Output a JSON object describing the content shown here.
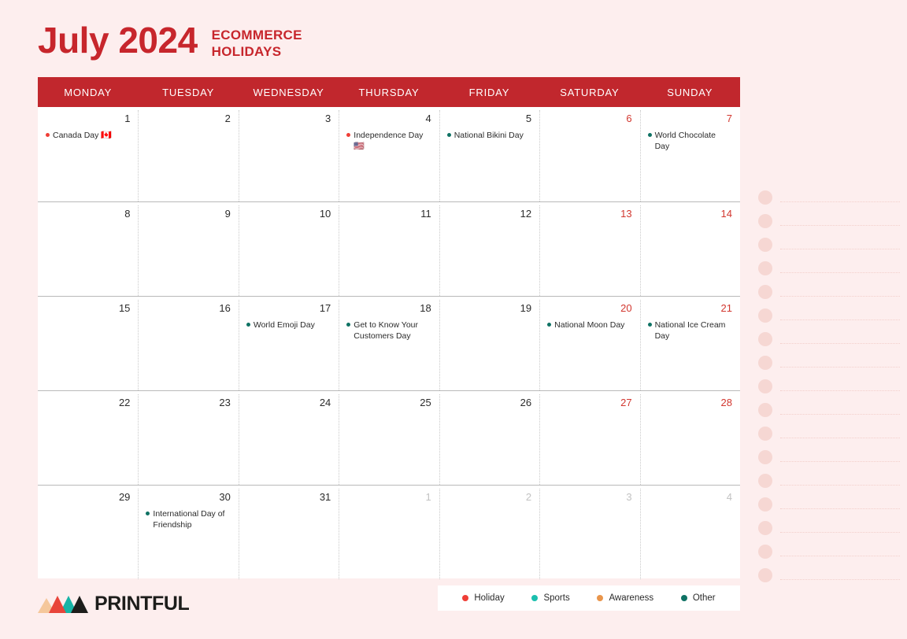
{
  "header": {
    "month_year": "July 2024",
    "subtitle_line1": "ECOMMERCE",
    "subtitle_line2": "HOLIDAYS",
    "accent_color": "#c7262c"
  },
  "calendar": {
    "weekday_headers": [
      "MONDAY",
      "TUESDAY",
      "WEDNESDAY",
      "THURSDAY",
      "FRIDAY",
      "SATURDAY",
      "SUNDAY"
    ],
    "header_bg": "#c1272d",
    "weeks": [
      [
        {
          "date": "1",
          "weekend": false,
          "muted": false,
          "events": [
            {
              "text": "Canada Day",
              "flag": "🇨🇦",
              "color": "#ef3e36",
              "category": "Holiday"
            }
          ]
        },
        {
          "date": "2",
          "weekend": false,
          "muted": false,
          "events": []
        },
        {
          "date": "3",
          "weekend": false,
          "muted": false,
          "events": []
        },
        {
          "date": "4",
          "weekend": false,
          "muted": false,
          "events": [
            {
              "text": "Independence Day",
              "flag": "🇺🇸",
              "color": "#ef3e36",
              "category": "Holiday"
            }
          ]
        },
        {
          "date": "5",
          "weekend": false,
          "muted": false,
          "events": [
            {
              "text": "National Bikini Day",
              "flag": "",
              "color": "#0f7264",
              "category": "Other"
            }
          ]
        },
        {
          "date": "6",
          "weekend": true,
          "muted": false,
          "events": []
        },
        {
          "date": "7",
          "weekend": true,
          "muted": false,
          "events": [
            {
              "text": "World Chocolate Day",
              "flag": "",
              "color": "#0f7264",
              "category": "Other"
            }
          ]
        }
      ],
      [
        {
          "date": "8",
          "weekend": false,
          "muted": false,
          "events": []
        },
        {
          "date": "9",
          "weekend": false,
          "muted": false,
          "events": []
        },
        {
          "date": "10",
          "weekend": false,
          "muted": false,
          "events": []
        },
        {
          "date": "11",
          "weekend": false,
          "muted": false,
          "events": []
        },
        {
          "date": "12",
          "weekend": false,
          "muted": false,
          "events": []
        },
        {
          "date": "13",
          "weekend": true,
          "muted": false,
          "events": []
        },
        {
          "date": "14",
          "weekend": true,
          "muted": false,
          "events": []
        }
      ],
      [
        {
          "date": "15",
          "weekend": false,
          "muted": false,
          "events": []
        },
        {
          "date": "16",
          "weekend": false,
          "muted": false,
          "events": []
        },
        {
          "date": "17",
          "weekend": false,
          "muted": false,
          "events": [
            {
              "text": "World Emoji Day",
              "flag": "",
              "color": "#0f7264",
              "category": "Other"
            }
          ]
        },
        {
          "date": "18",
          "weekend": false,
          "muted": false,
          "events": [
            {
              "text": "Get to Know Your Customers Day",
              "flag": "",
              "color": "#0f7264",
              "category": "Other"
            }
          ]
        },
        {
          "date": "19",
          "weekend": false,
          "muted": false,
          "events": []
        },
        {
          "date": "20",
          "weekend": true,
          "muted": false,
          "events": [
            {
              "text": "National Moon Day",
              "flag": "",
              "color": "#0f7264",
              "category": "Other"
            }
          ]
        },
        {
          "date": "21",
          "weekend": true,
          "muted": false,
          "events": [
            {
              "text": "National Ice Cream Day",
              "flag": "",
              "color": "#0f7264",
              "category": "Other"
            }
          ]
        }
      ],
      [
        {
          "date": "22",
          "weekend": false,
          "muted": false,
          "events": []
        },
        {
          "date": "23",
          "weekend": false,
          "muted": false,
          "events": []
        },
        {
          "date": "24",
          "weekend": false,
          "muted": false,
          "events": []
        },
        {
          "date": "25",
          "weekend": false,
          "muted": false,
          "events": []
        },
        {
          "date": "26",
          "weekend": false,
          "muted": false,
          "events": []
        },
        {
          "date": "27",
          "weekend": true,
          "muted": false,
          "events": []
        },
        {
          "date": "28",
          "weekend": true,
          "muted": false,
          "events": []
        }
      ],
      [
        {
          "date": "29",
          "weekend": false,
          "muted": false,
          "events": []
        },
        {
          "date": "30",
          "weekend": false,
          "muted": false,
          "events": [
            {
              "text": "International Day of Friendship",
              "flag": "",
              "color": "#0f7264",
              "category": "Other"
            }
          ]
        },
        {
          "date": "31",
          "weekend": false,
          "muted": false,
          "events": []
        },
        {
          "date": "1",
          "weekend": false,
          "muted": true,
          "events": []
        },
        {
          "date": "2",
          "weekend": false,
          "muted": true,
          "events": []
        },
        {
          "date": "3",
          "weekend": true,
          "muted": true,
          "events": []
        },
        {
          "date": "4",
          "weekend": true,
          "muted": true,
          "events": []
        }
      ]
    ]
  },
  "legend": {
    "items": [
      {
        "label": "Holiday",
        "color": "#ef3e36"
      },
      {
        "label": "Sports",
        "color": "#1bbfae"
      },
      {
        "label": "Awareness",
        "color": "#e9954b"
      },
      {
        "label": "Other",
        "color": "#0f7264"
      }
    ]
  },
  "footer": {
    "brand": "PRINTFUL"
  },
  "checklist": {
    "rows": 17
  }
}
